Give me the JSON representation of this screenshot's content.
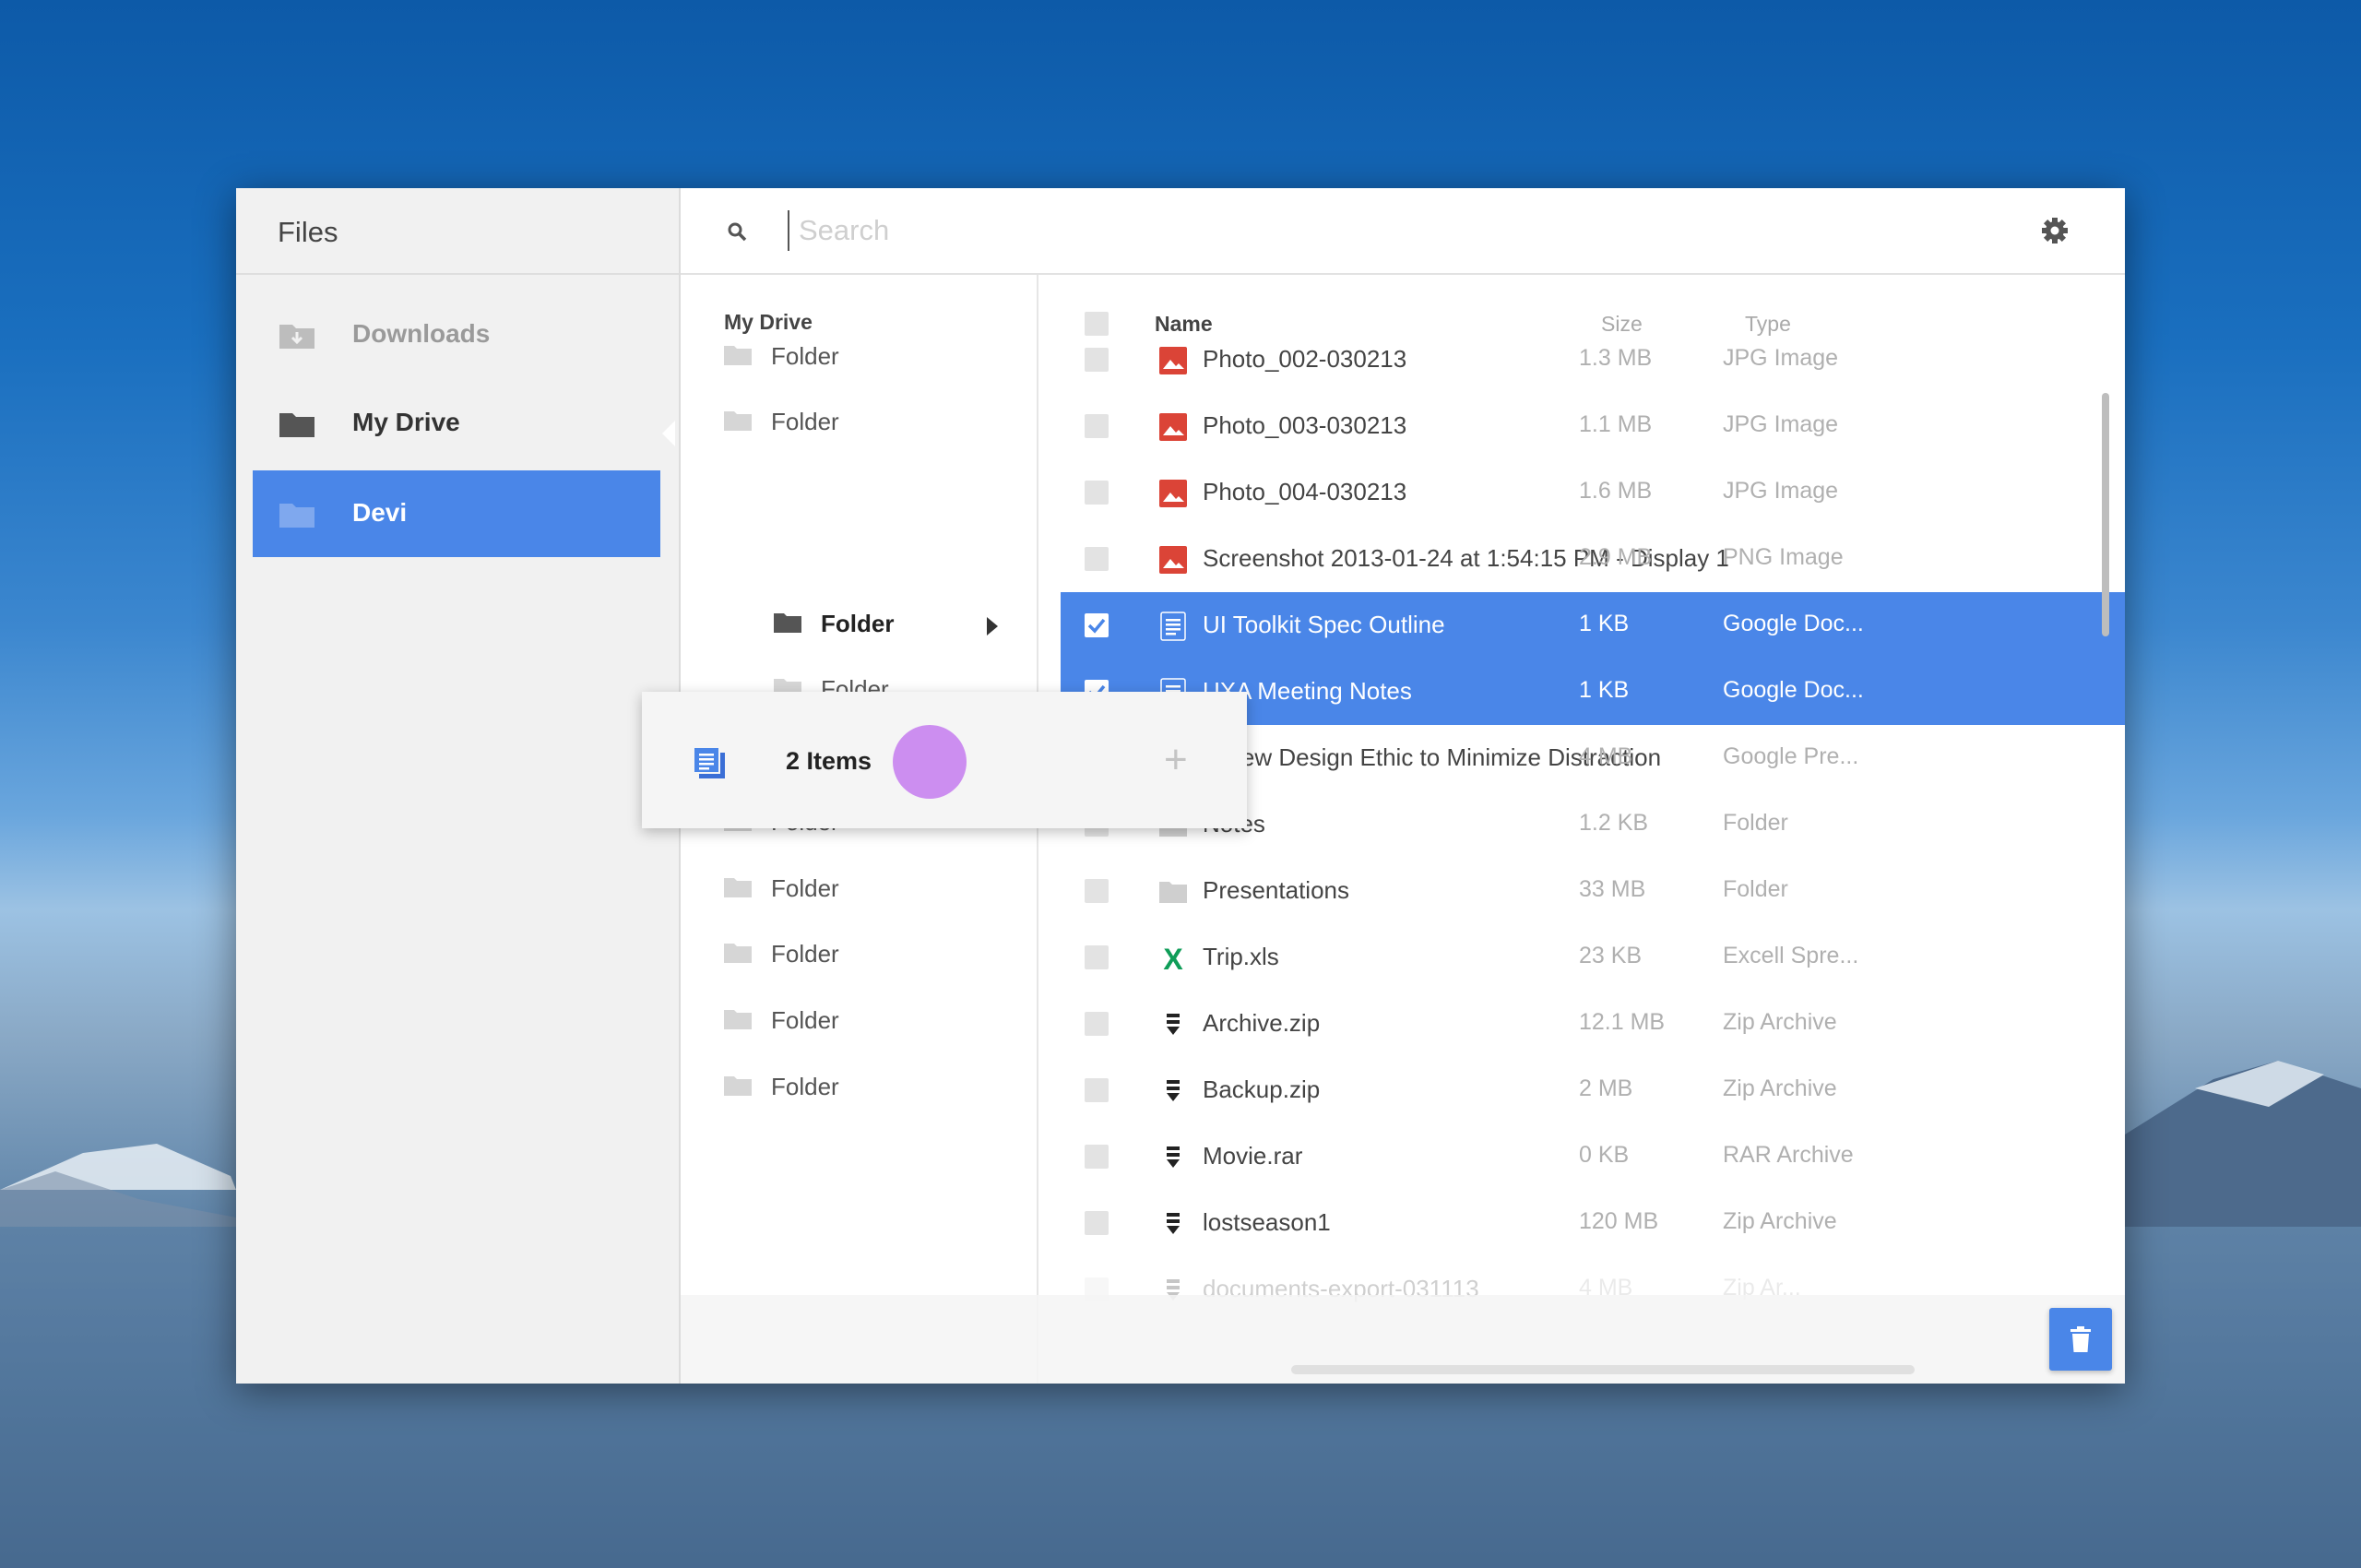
{
  "app": {
    "title": "Files"
  },
  "sidebar": {
    "items": [
      {
        "label": "Downloads",
        "icon": "download-folder-icon",
        "color": "#9a9a9a"
      },
      {
        "label": "My Drive",
        "icon": "drive-folder-icon",
        "color": "#333333"
      },
      {
        "label": "Devi",
        "icon": "folder-icon",
        "color": "#ffffff",
        "active": true
      }
    ]
  },
  "search": {
    "placeholder": "Search",
    "value": ""
  },
  "toolbar": {
    "icons": [
      "gear-icon",
      "list-view-icon",
      "maximize-icon",
      "close-icon"
    ]
  },
  "tree": {
    "title": "My Drive",
    "items": [
      {
        "label": "Folder",
        "level": 0
      },
      {
        "label": "Folder",
        "level": 0
      },
      {
        "label": "Folder",
        "level": 1,
        "selected": true,
        "expandable": true
      },
      {
        "label": "Folder",
        "level": 1
      },
      {
        "label": "Folder",
        "level": 1
      },
      {
        "label": "Folder",
        "level": 0
      },
      {
        "label": "Folder",
        "level": 0
      },
      {
        "label": "Folder",
        "level": 0
      },
      {
        "label": "Folder",
        "level": 0
      },
      {
        "label": "Folder",
        "level": 0
      }
    ]
  },
  "filelist": {
    "headers": {
      "name": "Name",
      "size": "Size",
      "type": "Type"
    },
    "rows": [
      {
        "name": "Photo_002-030213",
        "size": "1.3 MB",
        "type": "JPG Image",
        "icon": "image-icon",
        "selected": false
      },
      {
        "name": "Photo_003-030213",
        "size": "1.1 MB",
        "type": "JPG Image",
        "icon": "image-icon",
        "selected": false
      },
      {
        "name": "Photo_004-030213",
        "size": "1.6 MB",
        "type": "JPG Image",
        "icon": "image-icon",
        "selected": false
      },
      {
        "name": "Screenshot 2013-01-24 at 1:54:15 PM - Display 1",
        "size": "2.9 MB",
        "type": "PNG Image",
        "icon": "image-icon",
        "selected": false
      },
      {
        "name": "UI Toolkit Spec Outline",
        "size": "1 KB",
        "type": "Google Doc...",
        "icon": "doc-icon",
        "selected": true
      },
      {
        "name": "UXA Meeting Notes",
        "size": "1 KB",
        "type": "Google Doc...",
        "icon": "doc-icon",
        "selected": true
      },
      {
        "name": "A New Design Ethic to Minimize Distraction",
        "size": "4 MB",
        "type": "Google Pre...",
        "icon": "slides-icon",
        "selected": false
      },
      {
        "name": "Notes",
        "size": "1.2 KB",
        "type": "Folder",
        "icon": "folder-icon",
        "selected": false
      },
      {
        "name": "Presentations",
        "size": "33 MB",
        "type": "Folder",
        "icon": "folder-icon",
        "selected": false
      },
      {
        "name": "Trip.xls",
        "size": "23 KB",
        "type": "Excell Spre...",
        "icon": "excel-icon",
        "selected": false
      },
      {
        "name": "Archive.zip",
        "size": "12.1 MB",
        "type": "Zip Archive",
        "icon": "zip-icon",
        "selected": false
      },
      {
        "name": "Backup.zip",
        "size": "2 MB",
        "type": "Zip Archive",
        "icon": "zip-icon",
        "selected": false
      },
      {
        "name": "Movie.rar",
        "size": "0 KB",
        "type": "RAR Archive",
        "icon": "zip-icon",
        "selected": false
      },
      {
        "name": "lostseason1",
        "size": "120 MB",
        "type": "Zip Archive",
        "icon": "zip-icon",
        "selected": false
      },
      {
        "name": "documents-export-031113",
        "size": "4 MB",
        "type": "Zip Ar...",
        "icon": "zip-icon",
        "selected": false,
        "faded": true
      }
    ]
  },
  "drag": {
    "label": "2 Items",
    "icon": "docs-stack-icon",
    "accent": "#cc8ef0"
  },
  "colors": {
    "accent": "#4a86e8",
    "image_red": "#db4437",
    "excel_green": "#0f9d58",
    "slides_yellow": "#f4b400"
  }
}
